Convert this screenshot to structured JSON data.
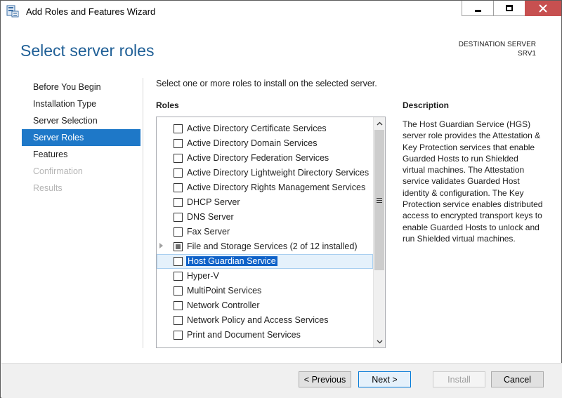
{
  "window": {
    "title": "Add Roles and Features Wizard"
  },
  "header": {
    "page_title": "Select server roles",
    "destination_label": "DESTINATION SERVER",
    "destination_value": "SRV1"
  },
  "nav": {
    "items": [
      {
        "label": "Before You Begin",
        "state": "normal"
      },
      {
        "label": "Installation Type",
        "state": "normal"
      },
      {
        "label": "Server Selection",
        "state": "normal"
      },
      {
        "label": "Server Roles",
        "state": "selected"
      },
      {
        "label": "Features",
        "state": "normal"
      },
      {
        "label": "Confirmation",
        "state": "disabled"
      },
      {
        "label": "Results",
        "state": "disabled"
      }
    ]
  },
  "main": {
    "instruction": "Select one or more roles to install on the selected server.",
    "roles_label": "Roles",
    "roles": [
      {
        "label": "Active Directory Certificate Services",
        "checked": false
      },
      {
        "label": "Active Directory Domain Services",
        "checked": false
      },
      {
        "label": "Active Directory Federation Services",
        "checked": false
      },
      {
        "label": "Active Directory Lightweight Directory Services",
        "checked": false
      },
      {
        "label": "Active Directory Rights Management Services",
        "checked": false
      },
      {
        "label": "DHCP Server",
        "checked": false
      },
      {
        "label": "DNS Server",
        "checked": false
      },
      {
        "label": "Fax Server",
        "checked": false
      },
      {
        "label": "File and Storage Services (2 of 12 installed)",
        "checked": "partial",
        "expandable": true
      },
      {
        "label": "Host Guardian Service",
        "checked": false,
        "selected": true
      },
      {
        "label": "Hyper-V",
        "checked": false
      },
      {
        "label": "MultiPoint Services",
        "checked": false
      },
      {
        "label": "Network Controller",
        "checked": false
      },
      {
        "label": "Network Policy and Access Services",
        "checked": false
      },
      {
        "label": "Print and Document Services",
        "checked": false
      }
    ]
  },
  "description": {
    "title": "Description",
    "text": "The Host Guardian Service (HGS) server role provides the Attestation & Key Protection services that enable Guarded Hosts to run Shielded virtual machines. The Attestation service validates Guarded Host identity & configuration. The Key Protection service enables distributed access to encrypted transport keys to enable Guarded Hosts to unlock and run Shielded virtual machines."
  },
  "footer": {
    "previous": "< Previous",
    "next": "Next >",
    "install": "Install",
    "cancel": "Cancel"
  },
  "colors": {
    "accent": "#1e78c8",
    "title_blue": "#1f5f96",
    "close_red": "#c75050",
    "selection": "#0f62c8"
  }
}
